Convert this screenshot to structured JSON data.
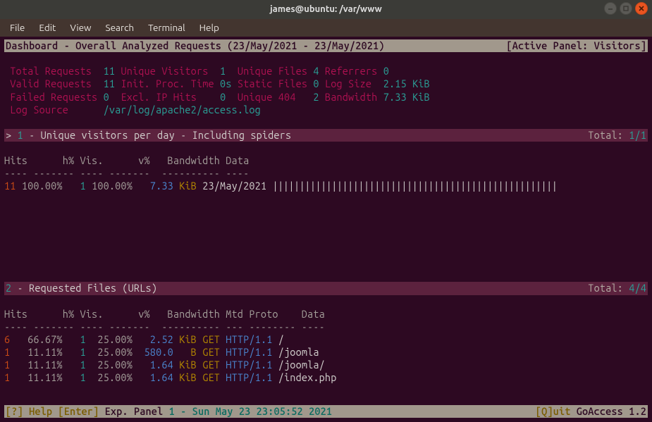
{
  "window": {
    "title": "james@ubuntu: /var/www"
  },
  "menu": [
    "File",
    "Edit",
    "View",
    "Search",
    "Terminal",
    "Help"
  ],
  "dashboard": {
    "title_left": "Dashboard - Overall Analyzed Requests (23/May/2021 - 23/May/2021)",
    "title_right": "[Active Panel: Visitors]"
  },
  "stats": {
    "total_requests_label": "Total Requests",
    "total_requests": "11",
    "unique_visitors_label": "Unique Visitors",
    "unique_visitors": "1",
    "unique_files_label": "Unique Files",
    "unique_files": "4",
    "referrers_label": "Referrers",
    "referrers": "0",
    "valid_requests_label": "Valid Requests",
    "valid_requests": "11",
    "init_proc_label": "Init. Proc. Time",
    "init_proc": "0s",
    "static_files_label": "Static Files",
    "static_files": "0",
    "log_size_label": "Log Size",
    "log_size": "2.15 KiB",
    "failed_requests_label": "Failed Requests",
    "failed_requests": "0",
    "excl_ip_label": "Excl. IP Hits",
    "excl_ip": "0",
    "unique_404_label": "Unique 404",
    "unique_404": "2",
    "bandwidth_label": "Bandwidth",
    "bandwidth": "7.33 KiB",
    "log_source_label": "Log Source",
    "log_source": "/var/log/apache2/access.log"
  },
  "panel1": {
    "marker": "> ",
    "num": "1",
    "title": " - Unique visitors per day - Including spiders",
    "total_label": "Total: ",
    "total": "1/1",
    "headers": "Hits      h% Vis.      v%   Bandwidth Data",
    "dashes": "---- ------- ---- -------  ---------- ----",
    "rows": [
      {
        "hits": "11",
        "hp": " 100.00%",
        "vis": "   1",
        "vp": " 100.00%",
        "bw": "   7.33 ",
        "unit": "KiB",
        "data": " 23/May/2021 "
      }
    ],
    "bargraph": "|||||||||||||||||||||||||||||||||||||||||||||||||||||"
  },
  "panel2": {
    "num": "2",
    "title": " - Requested Files (URLs)",
    "total_label": "Total: ",
    "total": "4/4",
    "headers": "Hits      h% Vis.      v%   Bandwidth Mtd Proto    Data",
    "dashes": "---- ------- ---- -------  ---------- --- -------- ----",
    "rows": [
      {
        "hits": "6 ",
        "hp": "  66.67%",
        "vis": "   1",
        "vp": "  25.00%",
        "bw": "   2.52",
        "unit": " KiB",
        "mtd": " GET",
        "proto": " HTTP/1.1",
        "data": " /"
      },
      {
        "hits": "1 ",
        "hp": "  11.11%",
        "vis": "   1",
        "vp": "  25.00%",
        "bw": "  580.0",
        "unit": "   B",
        "mtd": " GET",
        "proto": " HTTP/1.1",
        "data": " /joomla"
      },
      {
        "hits": "1 ",
        "hp": "  11.11%",
        "vis": "   1",
        "vp": "  25.00%",
        "bw": "   1.64",
        "unit": " KiB",
        "mtd": " GET",
        "proto": " HTTP/1.1",
        "data": " /joomla/"
      },
      {
        "hits": "1 ",
        "hp": "  11.11%",
        "vis": "   1",
        "vp": "  25.00%",
        "bw": "   1.64",
        "unit": " KiB",
        "mtd": " GET",
        "proto": " HTTP/1.1",
        "data": " /index.php"
      }
    ]
  },
  "status": {
    "left_parts": {
      "help": "[?] Help ",
      "enter": "[Enter] ",
      "exp": "Exp. Panel  ",
      "panel": "1 - Sun May 23 23:05:52 2021"
    },
    "right_parts": {
      "quit": "[Q]uit ",
      "app": "GoAccess 1.2 "
    }
  }
}
